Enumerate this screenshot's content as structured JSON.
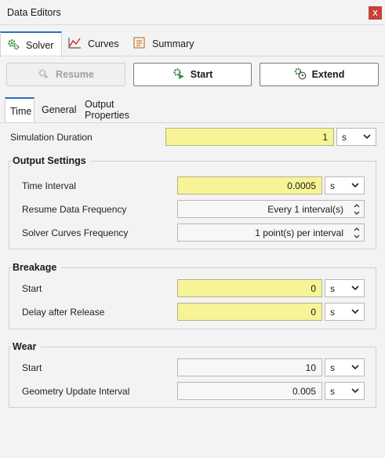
{
  "window": {
    "title": "Data Editors",
    "close_glyph": "x"
  },
  "main_tabs": [
    {
      "label": "Solver",
      "icon": "gears-icon"
    },
    {
      "label": "Curves",
      "icon": "line-chart-icon"
    },
    {
      "label": "Summary",
      "icon": "document-list-icon"
    }
  ],
  "toolbar": {
    "resume_label": "Resume",
    "start_label": "Start",
    "extend_label": "Extend"
  },
  "sub_tabs": [
    "Time",
    "General",
    "Output Properties"
  ],
  "simulation": {
    "label": "Simulation Duration",
    "value": "1",
    "unit": "s"
  },
  "output_settings": {
    "title": "Output Settings",
    "time_interval": {
      "label": "Time Interval",
      "value": "0.0005",
      "unit": "s"
    },
    "resume_freq": {
      "label": "Resume Data Frequency",
      "value": "Every 1 interval(s)"
    },
    "curves_freq": {
      "label": "Solver Curves Frequency",
      "value": "1 point(s) per interval"
    }
  },
  "breakage": {
    "title": "Breakage",
    "start": {
      "label": "Start",
      "value": "0",
      "unit": "s"
    },
    "delay": {
      "label": "Delay after Release",
      "value": "0",
      "unit": "s"
    }
  },
  "wear": {
    "title": "Wear",
    "start": {
      "label": "Start",
      "value": "10",
      "unit": "s"
    },
    "geometry": {
      "label": "Geometry Update Interval",
      "value": "0.005",
      "unit": "s"
    }
  },
  "colors": {
    "accent": "#2d6fc0",
    "editable_field": "#f7f497",
    "close": "#c8413a",
    "start_icon": "#2a9d4a"
  }
}
